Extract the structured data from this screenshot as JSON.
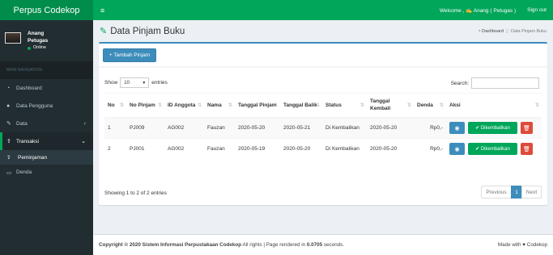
{
  "app": {
    "title": "Perpus Codekop",
    "menu_icon": "≡"
  },
  "topbar": {
    "welcome": "Welcome , ✍ Anang ( Petugas )",
    "signout": "Sign out"
  },
  "user": {
    "name": "Anang",
    "role": "Petugas",
    "status": "Online"
  },
  "sidebar": {
    "header": "MAIN NAVIGATION",
    "items": [
      {
        "label": "Dashboard",
        "icon": "dashboard-icon"
      },
      {
        "label": "Data Pengguna",
        "icon": "user-icon"
      },
      {
        "label": "Data",
        "icon": "edit-icon"
      },
      {
        "label": "Transaksi",
        "icon": "upload-icon"
      },
      {
        "label": "Peminjaman",
        "icon": "upload-icon"
      },
      {
        "label": "Denda",
        "icon": "money-icon"
      }
    ]
  },
  "page": {
    "title": "Data Pinjam Buku",
    "breadcrumb": [
      "Dashboard",
      "Data Pinjam Buku"
    ],
    "add_button": "+ Tambah Pinjam"
  },
  "table_controls": {
    "show": "Show",
    "entries_value": "10",
    "entries": "entries",
    "search": "Search:"
  },
  "table": {
    "headers": [
      "No",
      "No Pinjam",
      "ID Anggota",
      "Nama",
      "Tanggal Pinjam",
      "Tanggal Balik",
      "Status",
      "Tanggal Kembali",
      "Denda",
      "Aksi"
    ],
    "rows": [
      {
        "no": "1",
        "no_pinjam": "PJ009",
        "id_anggota": "AG002",
        "nama": "Fauzan",
        "tgl_pinjam": "2020-05-20",
        "tgl_balik": "2020-05-21",
        "status": "Di Kembalikan",
        "tgl_kembali": "2020-05-20",
        "denda": "Rp0,-"
      },
      {
        "no": "2",
        "no_pinjam": "PJ001",
        "id_anggota": "AG002",
        "nama": "Fauzan",
        "tgl_pinjam": "2020-05-19",
        "tgl_balik": "2020-05-20",
        "status": "Di Kembalikan",
        "tgl_kembali": "2020-05-20",
        "denda": "Rp0,-"
      }
    ],
    "action_label": "Dikembalikan"
  },
  "pagination": {
    "info": "Showing 1 to 2 of 2 entries",
    "prev": "Previous",
    "page": "1",
    "next": "Next"
  },
  "footer": {
    "copyright": "Copyright © 2020 Sistem Informasi Perpustakaan Codekop",
    "rights": " All rights | Page rendered in ",
    "time": "0.0705",
    "seconds": " seconds.",
    "made": "Made with ♥ Codekop"
  },
  "colors": {
    "brand": "#00a65a",
    "primary": "#3c8dbc",
    "danger": "#dd4b39",
    "sidebar": "#222d32"
  }
}
